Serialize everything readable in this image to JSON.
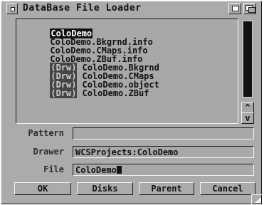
{
  "window": {
    "title": "DataBase File Loader"
  },
  "file_list": {
    "items": [
      {
        "prefix": "",
        "name": "ColoDemo",
        "selected": true
      },
      {
        "prefix": "",
        "name": "ColoDemo.Bkgrnd.info",
        "selected": false
      },
      {
        "prefix": "",
        "name": "ColoDemo.CMaps.info",
        "selected": false
      },
      {
        "prefix": "",
        "name": "ColoDemo.ZBuf.info",
        "selected": false
      },
      {
        "prefix": "(Drw)",
        "name": "ColoDemo.Bkgrnd",
        "selected": false
      },
      {
        "prefix": "(Drw)",
        "name": "ColoDemo.CMaps",
        "selected": false
      },
      {
        "prefix": "(Drw)",
        "name": "ColoDemo.object",
        "selected": false
      },
      {
        "prefix": "(Drw)",
        "name": "ColoDemo.ZBuf",
        "selected": false
      }
    ]
  },
  "scrollbar": {
    "up_glyph": "^",
    "down_glyph": "v"
  },
  "fields": {
    "pattern": {
      "label": "Pattern",
      "value": ""
    },
    "drawer": {
      "label": "Drawer",
      "value": "WCSProjects:ColoDemo"
    },
    "file": {
      "label": "File",
      "value": "ColoDemo"
    }
  },
  "buttons": {
    "ok": "OK",
    "disks": "Disks",
    "parent": "Parent",
    "cancel": "Cancel"
  },
  "colors": {
    "window_bg": "#ababab",
    "highlight": "#f2f2f2",
    "shadow": "#1c1c1c",
    "selected_bg": "#111111",
    "drawer_tag_bg": "#454545"
  }
}
